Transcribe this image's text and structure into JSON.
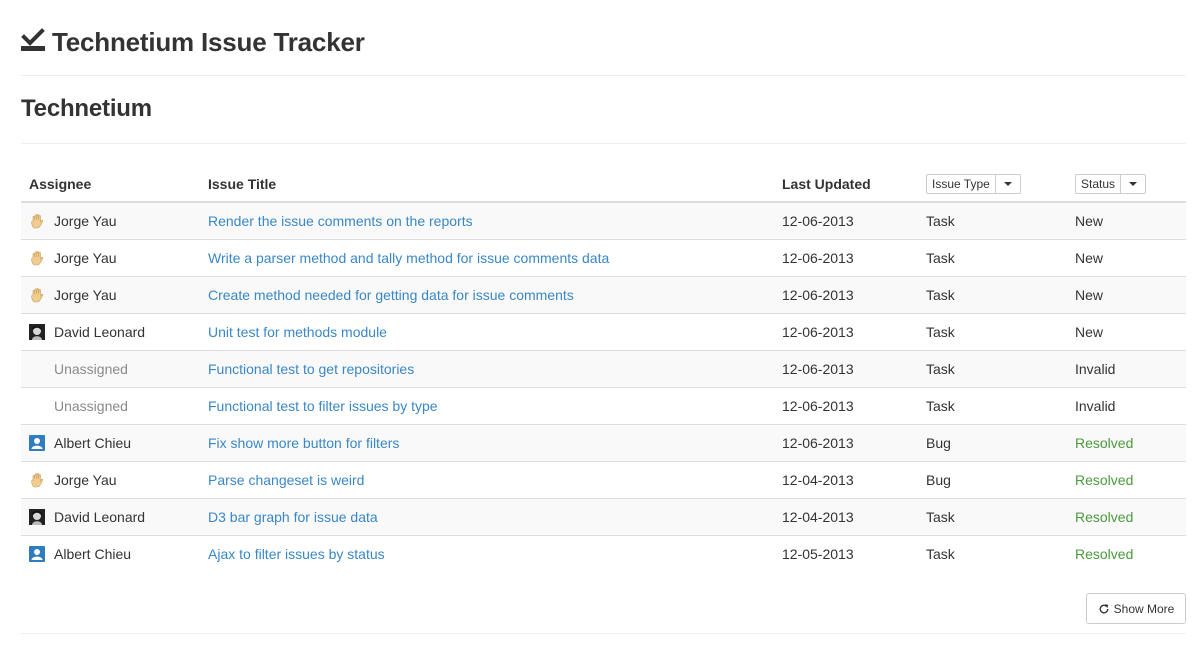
{
  "app": {
    "title": "Technetium Issue Tracker",
    "logo_icon": "checkbox-underline-icon"
  },
  "project": {
    "title": "Technetium"
  },
  "table": {
    "headers": {
      "assignee": "Assignee",
      "issue_title": "Issue Title",
      "last_updated": "Last Updated"
    },
    "filters": {
      "issue_type": {
        "label": "Issue Type",
        "icon": "caret-down-icon"
      },
      "status": {
        "label": "Status",
        "icon": "caret-down-icon"
      }
    },
    "rows": [
      {
        "assignee": "Jorge Yau",
        "avatar": "hand-avatar",
        "title": "Render the issue comments on the reports",
        "updated": "12-06-2013",
        "type": "Task",
        "status": "New"
      },
      {
        "assignee": "Jorge Yau",
        "avatar": "hand-avatar",
        "title": "Write a parser method and tally method for issue comments data",
        "updated": "12-06-2013",
        "type": "Task",
        "status": "New"
      },
      {
        "assignee": "Jorge Yau",
        "avatar": "hand-avatar",
        "title": "Create method needed for getting data for issue comments",
        "updated": "12-06-2013",
        "type": "Task",
        "status": "New"
      },
      {
        "assignee": "David Leonard",
        "avatar": "photo-avatar",
        "title": "Unit test for methods module",
        "updated": "12-06-2013",
        "type": "Task",
        "status": "New"
      },
      {
        "assignee": "Unassigned",
        "avatar": "none",
        "title": "Functional test to get repositories",
        "updated": "12-06-2013",
        "type": "Task",
        "status": "Invalid"
      },
      {
        "assignee": "Unassigned",
        "avatar": "none",
        "title": "Functional test to filter issues by type",
        "updated": "12-06-2013",
        "type": "Task",
        "status": "Invalid"
      },
      {
        "assignee": "Albert Chieu",
        "avatar": "default-user-avatar",
        "title": "Fix show more button for filters",
        "updated": "12-06-2013",
        "type": "Bug",
        "status": "Resolved"
      },
      {
        "assignee": "Jorge Yau",
        "avatar": "hand-avatar",
        "title": "Parse changeset is weird",
        "updated": "12-04-2013",
        "type": "Bug",
        "status": "Resolved"
      },
      {
        "assignee": "David Leonard",
        "avatar": "photo-avatar",
        "title": "D3 bar graph for issue data",
        "updated": "12-04-2013",
        "type": "Task",
        "status": "Resolved"
      },
      {
        "assignee": "Albert Chieu",
        "avatar": "default-user-avatar",
        "title": "Ajax to filter issues by status",
        "updated": "12-05-2013",
        "type": "Task",
        "status": "Resolved"
      }
    ]
  },
  "show_more": {
    "label": "Show More",
    "icon": "refresh-icon"
  },
  "colors": {
    "link": "#3a87c7",
    "resolved": "#4b9a3c",
    "unassigned": "#8a8a8a",
    "row_stripe": "#f9f9f9"
  }
}
